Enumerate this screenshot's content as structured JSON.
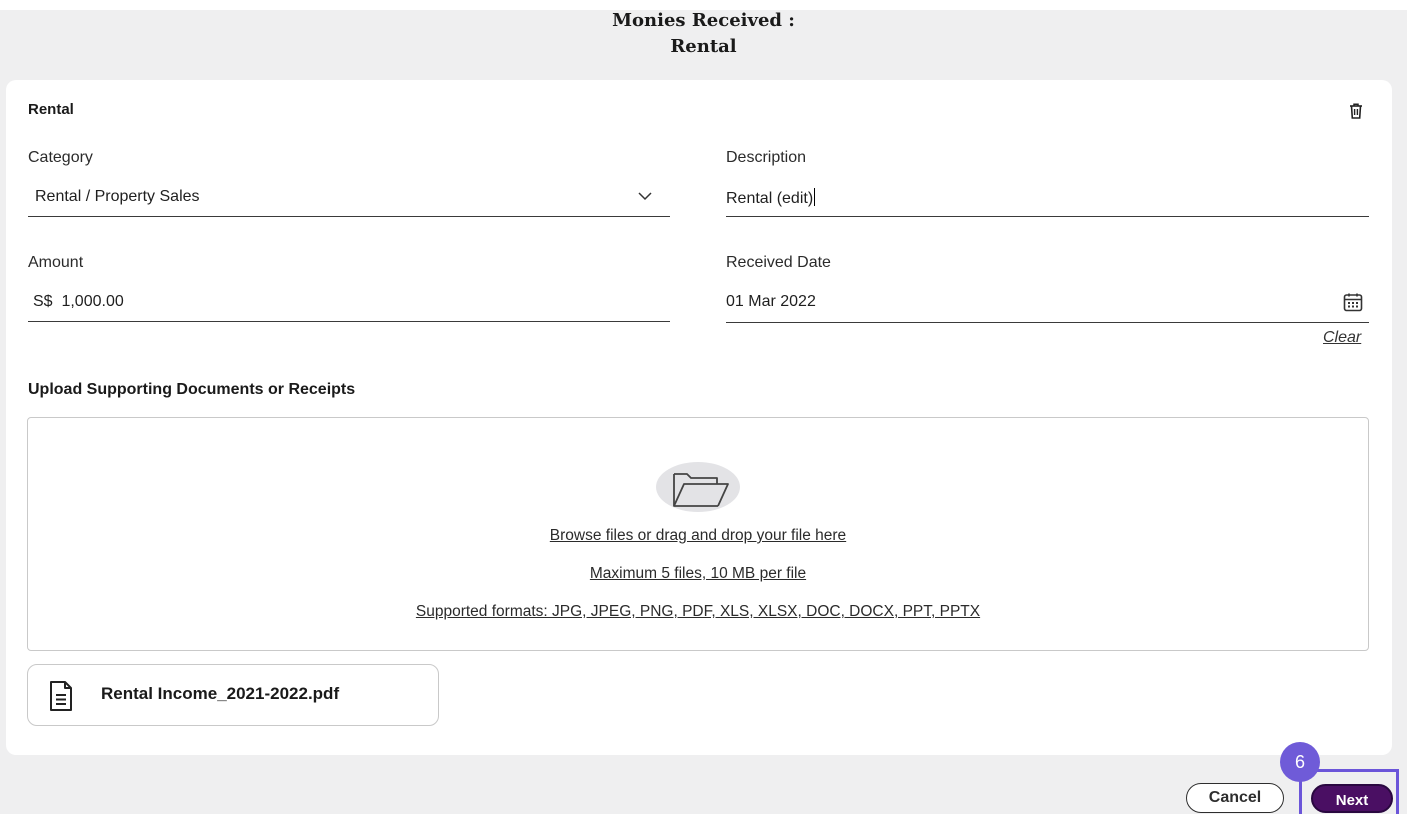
{
  "header": {
    "title_line1": "Monies Received :",
    "title_line2": "Rental"
  },
  "form": {
    "section_title": "Rental",
    "delete_icon": "trash-icon",
    "category": {
      "label": "Category",
      "value": "Rental / Property Sales",
      "icon": "chevron-down-icon"
    },
    "description": {
      "label": "Description",
      "value": "Rental (edit)"
    },
    "amount": {
      "label": "Amount",
      "value": "S$  1,000.00"
    },
    "received_date": {
      "label": "Received Date",
      "value": "01 Mar 2022",
      "icon": "calendar-icon",
      "clear_label": "Clear"
    }
  },
  "upload": {
    "heading": "Upload Supporting Documents or Receipts",
    "icon": "folder-icon",
    "browse_text": "Browse files or drag and drop your file here",
    "limit_text": "Maximum 5 files, 10 MB per file",
    "formats_text": "Supported formats: JPG, JPEG, PNG, PDF, XLS, XLSX, DOC, DOCX, PPT, PPTX",
    "files": [
      {
        "name": "Rental Income_2021-2022.pdf",
        "icon": "document-icon"
      }
    ]
  },
  "actions": {
    "cancel_label": "Cancel",
    "next_label": "Next",
    "step_number": "6"
  },
  "colors": {
    "primary": "#4a0f63",
    "highlight": "#6f5bd8",
    "background": "#efeff0"
  }
}
